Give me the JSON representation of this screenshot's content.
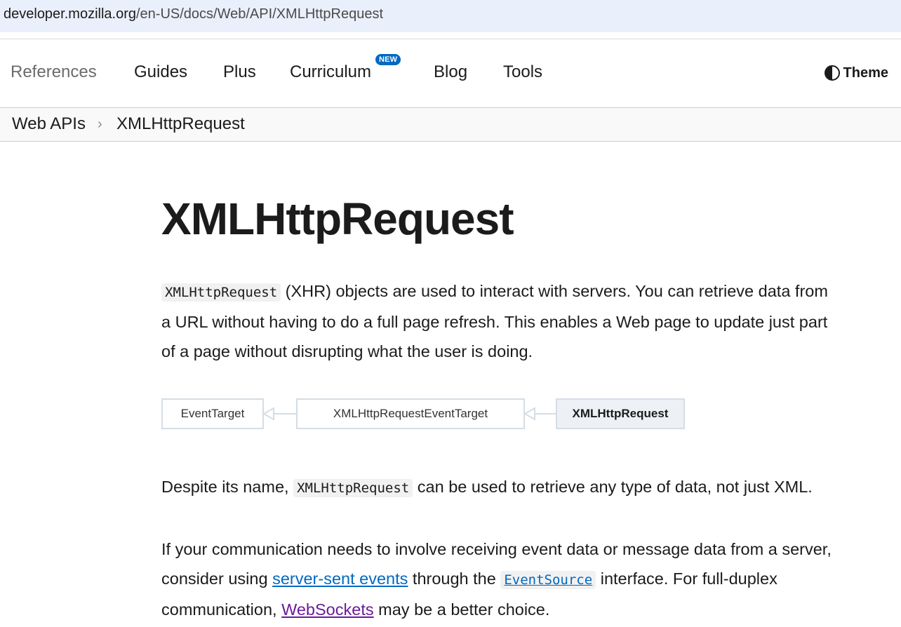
{
  "browser": {
    "url_host": "developer.mozilla.org",
    "url_path": "/en-US/docs/Web/API/XMLHttpRequest"
  },
  "nav": {
    "items": [
      {
        "label": "References"
      },
      {
        "label": "Guides"
      },
      {
        "label": "Plus"
      },
      {
        "label": "Curriculum",
        "badge": "NEW"
      },
      {
        "label": "Blog"
      },
      {
        "label": "Tools"
      }
    ],
    "theme_label": "Theme"
  },
  "breadcrumb": {
    "items": [
      "Web APIs",
      "XMLHttpRequest"
    ],
    "separator": "›"
  },
  "main": {
    "title": "XMLHttpRequest",
    "intro": {
      "code": "XMLHttpRequest",
      "line1_rest": " (XHR) objects are used to interact with servers. You can retrieve data from",
      "line2": "a URL without having to do a full page refresh. This enables a Web page to update just part",
      "line3": "of a page without disrupting what the user is doing."
    },
    "inheritance": [
      "EventTarget",
      "XMLHttpRequestEventTarget",
      "XMLHttpRequest"
    ],
    "para2": {
      "before": "Despite its name, ",
      "code": "XMLHttpRequest",
      "after": " can be used to retrieve any type of data, not just XML."
    },
    "para3": {
      "line1": "If your communication needs to involve receiving event data or message data from a server,",
      "l2_before": "consider using ",
      "link1": "server-sent events",
      "l2_mid": " through the ",
      "code_link": "EventSource",
      "l2_after": " interface. For full-duplex",
      "l3_before": "communication, ",
      "link2": "WebSockets",
      "l3_after": " may be a better choice."
    }
  },
  "colors": {
    "link": "#0069c2",
    "visited_link": "#6a1b9a",
    "badge_bg": "#0069c2"
  }
}
